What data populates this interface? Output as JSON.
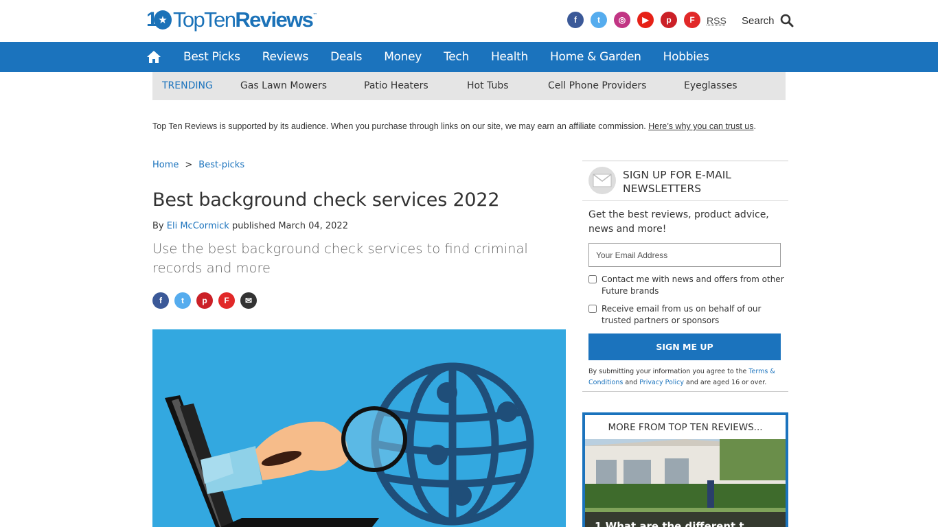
{
  "header": {
    "logo_text_plain": "TopTen",
    "logo_text_bold": "Reviews",
    "logo_mark": "10",
    "logo_tm": "™",
    "social": [
      {
        "name": "facebook-icon",
        "color": "#3b5998",
        "glyph": "f"
      },
      {
        "name": "twitter-icon",
        "color": "#55acee",
        "glyph": "t"
      },
      {
        "name": "instagram-icon",
        "color": "#c13584",
        "glyph": "◎"
      },
      {
        "name": "youtube-icon",
        "color": "#e62117",
        "glyph": "▶"
      },
      {
        "name": "pinterest-icon",
        "color": "#cb2027",
        "glyph": "p"
      },
      {
        "name": "flipboard-icon",
        "color": "#e12828",
        "glyph": "F"
      }
    ],
    "rss_label": "RSS",
    "search_label": "Search"
  },
  "nav": {
    "items": [
      "Best Picks",
      "Reviews",
      "Deals",
      "Money",
      "Tech",
      "Health",
      "Home & Garden",
      "Hobbies"
    ]
  },
  "trending": {
    "label": "TRENDING",
    "items": [
      "Gas Lawn Mowers",
      "Patio Heaters",
      "Hot Tubs",
      "Cell Phone Providers",
      "Eyeglasses"
    ]
  },
  "affiliate": {
    "text": "Top Ten Reviews is supported by its audience. When you purchase through links on our site, we may earn an affiliate commission.",
    "link": "Here’s why you can trust us",
    "end": "."
  },
  "breadcrumb": {
    "home": "Home",
    "sep": ">",
    "current": "Best-picks"
  },
  "article": {
    "title": "Best background check services 2022",
    "by": "By",
    "author": "Eli McCormick",
    "published": "published March 04, 2022",
    "strap": "Use the best background check services to find criminal records and more",
    "share": [
      {
        "name": "share-facebook-icon",
        "color": "#3b5998",
        "glyph": "f"
      },
      {
        "name": "share-twitter-icon",
        "color": "#55acee",
        "glyph": "t"
      },
      {
        "name": "share-pinterest-icon",
        "color": "#cb2027",
        "glyph": "p"
      },
      {
        "name": "share-flipboard-icon",
        "color": "#e12828",
        "glyph": "F"
      },
      {
        "name": "share-email-icon",
        "color": "#333333",
        "glyph": "✉"
      }
    ]
  },
  "newsletter": {
    "title": "SIGN UP FOR E-MAIL NEWSLETTERS",
    "description": "Get the best reviews, product advice, news and more!",
    "email_placeholder": "Your Email Address",
    "check1": "Contact me with news and offers from other Future brands",
    "check2": "Receive email from us on behalf of our trusted partners or sponsors",
    "button": "SIGN ME UP",
    "terms_pre": "By submitting your information you agree to the",
    "terms_link": "Terms & Conditions",
    "terms_and": "and",
    "privacy_link": "Privacy Policy",
    "terms_post": "and are aged 16 or over."
  },
  "more_from": {
    "heading": "MORE FROM TOP TEN REVIEWS...",
    "caption": "1   What are the different t"
  },
  "colors": {
    "brand_blue": "#1b73bd",
    "hero_bg": "#33a8e0"
  }
}
